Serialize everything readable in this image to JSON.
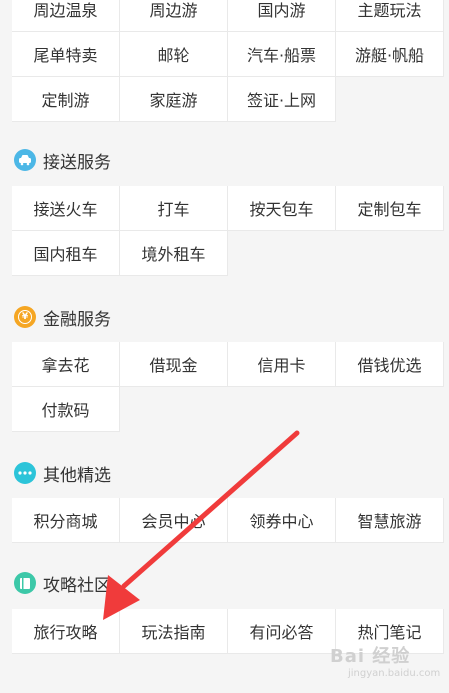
{
  "travel": {
    "row1": [
      "周边温泉",
      "周边游",
      "国内游",
      "主题玩法"
    ],
    "row2": [
      "尾单特卖",
      "邮轮",
      "汽车·船票",
      "游艇·帆船"
    ],
    "row3": [
      "定制游",
      "家庭游",
      "签证·上网"
    ]
  },
  "transfer": {
    "title": "接送服务",
    "icon": "car-icon",
    "color": "#4cb7e6",
    "items": [
      "接送火车",
      "打车",
      "按天包车",
      "定制包车",
      "国内租车",
      "境外租车"
    ]
  },
  "finance": {
    "title": "金融服务",
    "icon": "yuan-icon",
    "color": "#f5a623",
    "items": [
      "拿去花",
      "借现金",
      "信用卡",
      "借钱优选",
      "付款码"
    ]
  },
  "others": {
    "title": "其他精选",
    "icon": "more-icon",
    "color": "#2cc4d9",
    "items": [
      "积分商城",
      "会员中心",
      "领券中心",
      "智慧旅游"
    ]
  },
  "guide": {
    "title": "攻略社区",
    "icon": "book-icon",
    "color": "#3cc8a8",
    "items": [
      "旅行攻略",
      "玩法指南",
      "有问必答",
      "热门笔记"
    ]
  },
  "watermark": {
    "brand": "Bai 经验",
    "url": "jingyan.baidu.com"
  },
  "annotation": {
    "color": "#f03b3b"
  }
}
